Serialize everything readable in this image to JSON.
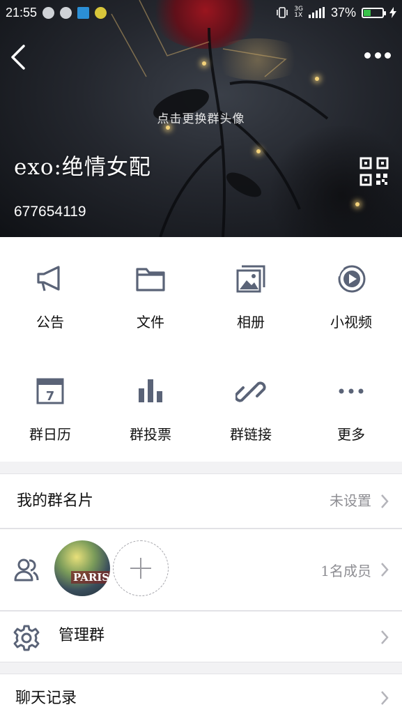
{
  "status_bar": {
    "time": "21:55",
    "network_top": "3G",
    "network_sub": "1X",
    "battery_percent": "37%",
    "battery_level": 0.37,
    "battery_color": "#3ac24a"
  },
  "header": {
    "change_avatar_hint": "点击更换群头像",
    "group_name": "exo:绝情女配",
    "group_id": "677654119"
  },
  "functions": [
    {
      "label": "公告",
      "icon": "megaphone-icon"
    },
    {
      "label": "文件",
      "icon": "folder-icon"
    },
    {
      "label": "相册",
      "icon": "album-icon"
    },
    {
      "label": "小视频",
      "icon": "video-icon"
    },
    {
      "label": "群日历",
      "icon": "calendar-icon"
    },
    {
      "label": "群投票",
      "icon": "bar-chart-icon"
    },
    {
      "label": "群链接",
      "icon": "link-icon"
    },
    {
      "label": "更多",
      "icon": "more-icon"
    }
  ],
  "calendar_day": "7",
  "my_card": {
    "title": "我的群名片",
    "value": "未设置"
  },
  "members": {
    "count_label": "1名成员",
    "avatar_text": "PARIS"
  },
  "manage": {
    "title": "管理群"
  },
  "chat_history": {
    "title": "聊天记录"
  },
  "colors": {
    "icon": "#5a6377",
    "secondary_text": "#8e8e93",
    "divider": "#e2e2e6",
    "background": "#f2f2f4"
  }
}
